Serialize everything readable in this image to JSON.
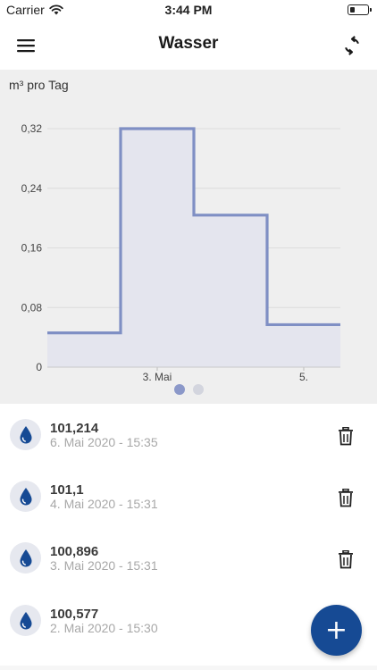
{
  "status_bar": {
    "carrier": "Carrier",
    "time": "3:44 PM",
    "battery_level": 0.25
  },
  "app_bar": {
    "title": "Wasser",
    "menu_icon": "hamburger-menu-icon",
    "sync_icon": "sync-icon"
  },
  "chart_data": {
    "type": "step-area",
    "unit_label": "m³ pro Tag",
    "y_ticks": [
      "0,32",
      "0,24",
      "0,16",
      "0,08",
      "0"
    ],
    "x_tick_labels": [
      "3. Mai",
      "5."
    ],
    "ylim": [
      0,
      0.32
    ],
    "x": [
      "2. Mai",
      "3. Mai",
      "4. Mai",
      "5. Mai"
    ],
    "values": [
      0.046,
      0.32,
      0.204,
      0.057
    ],
    "grid": true,
    "series_color": "#7f8fc4",
    "fill_color": "#e4e5ee"
  },
  "pager": {
    "pages": 2,
    "active": 0
  },
  "readings": [
    {
      "value": "101,214",
      "date": "6. Mai 2020 - 15:35",
      "deletable": true
    },
    {
      "value": "101,1",
      "date": "4. Mai 2020 - 15:31",
      "deletable": true
    },
    {
      "value": "100,896",
      "date": "3. Mai 2020 - 15:31",
      "deletable": true
    },
    {
      "value": "100,577",
      "date": "2. Mai 2020 - 15:30",
      "deletable": false
    }
  ],
  "fab": {
    "label": "+",
    "icon": "add-icon",
    "color": "#164a94"
  },
  "colors": {
    "accent": "#164a94",
    "drop": "#164a94",
    "chart_bg": "#efefef"
  }
}
